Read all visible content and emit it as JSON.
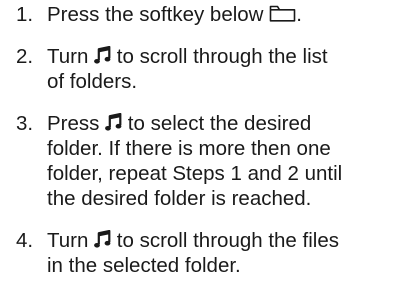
{
  "steps": [
    {
      "number": "1.",
      "lines": [
        {
          "before": "Press the softkey below ",
          "icon": "folder-icon",
          "after": "."
        }
      ]
    },
    {
      "number": "2.",
      "lines": [
        {
          "before": "Turn ",
          "icon": "music-note-icon",
          "after": " to scroll through the list"
        },
        {
          "text": "of folders."
        }
      ]
    },
    {
      "number": "3.",
      "lines": [
        {
          "before": "Press ",
          "icon": "music-note-icon",
          "after": " to select the desired"
        },
        {
          "text": "folder. If there is more then one"
        },
        {
          "text": "folder, repeat Steps 1 and 2 until"
        },
        {
          "text": "the desired folder is reached."
        }
      ]
    },
    {
      "number": "4.",
      "lines": [
        {
          "before": "Turn ",
          "icon": "music-note-icon",
          "after": " to scroll through the files"
        },
        {
          "text": "in the selected folder."
        }
      ]
    }
  ]
}
